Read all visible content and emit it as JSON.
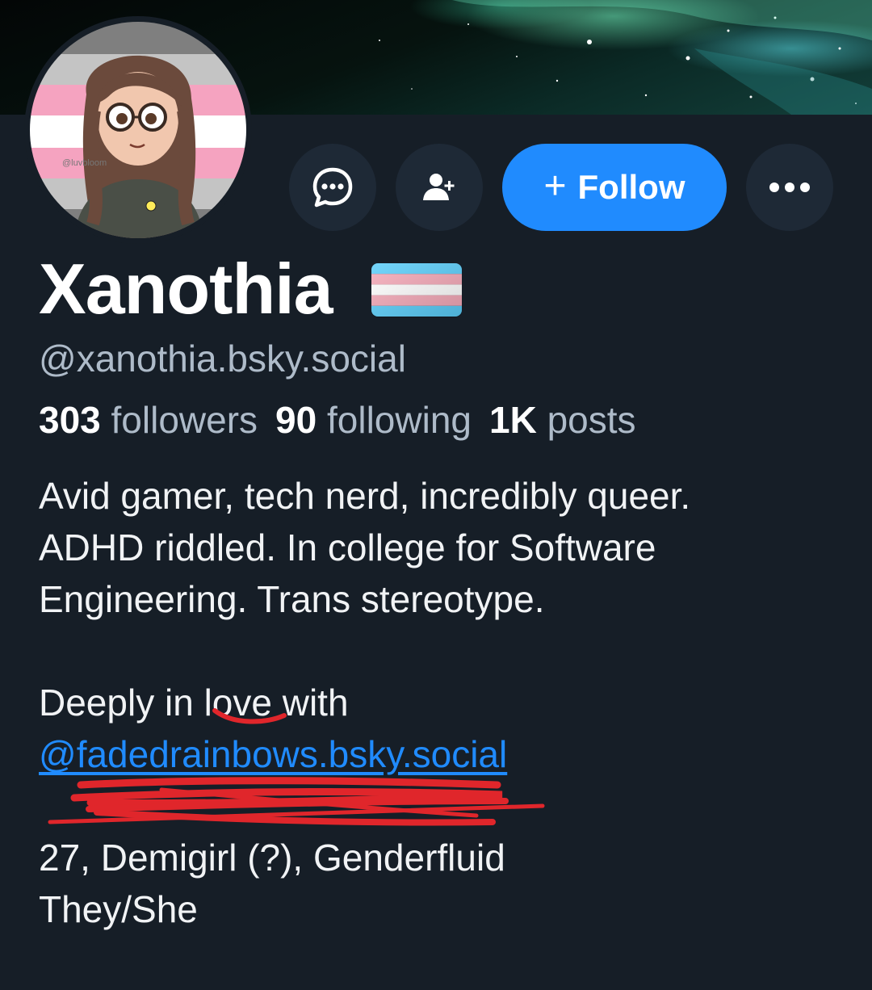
{
  "banner": {
    "description_icon": "galaxy-banner"
  },
  "profile": {
    "display_name": "Xanothia",
    "name_emoji": "transgender-flag",
    "handle": "@xanothia.bsky.social",
    "avatar_watermark": "@luvbloom"
  },
  "actions": {
    "message_icon": "chat-bubble-icon",
    "add_user_icon": "person-plus-icon",
    "follow_plus": "+",
    "follow_label": "Follow",
    "more_icon": "ellipsis-icon"
  },
  "stats": {
    "followers_count": "303",
    "followers_label": "followers",
    "following_count": "90",
    "following_label": "following",
    "posts_count": "1K",
    "posts_label": "posts"
  },
  "bio": {
    "line1": "Avid gamer, tech nerd, incredibly queer.",
    "line2": "ADHD riddled. In college for Software",
    "line3": "Engineering. Trans stereotype.",
    "line4_pre": "Deeply in ",
    "line4_love": "love",
    "line4_post": " with",
    "mention": "@fadedrainbows.bsky.social",
    "line6": "27, Demigirl (?), Genderfluid",
    "line7": "They/She"
  },
  "colors": {
    "background": "#161e27",
    "accent": "#208bfe",
    "muted_text": "#aebbc9",
    "button_bg": "#1e2936",
    "annotation_red": "#e0262b"
  }
}
